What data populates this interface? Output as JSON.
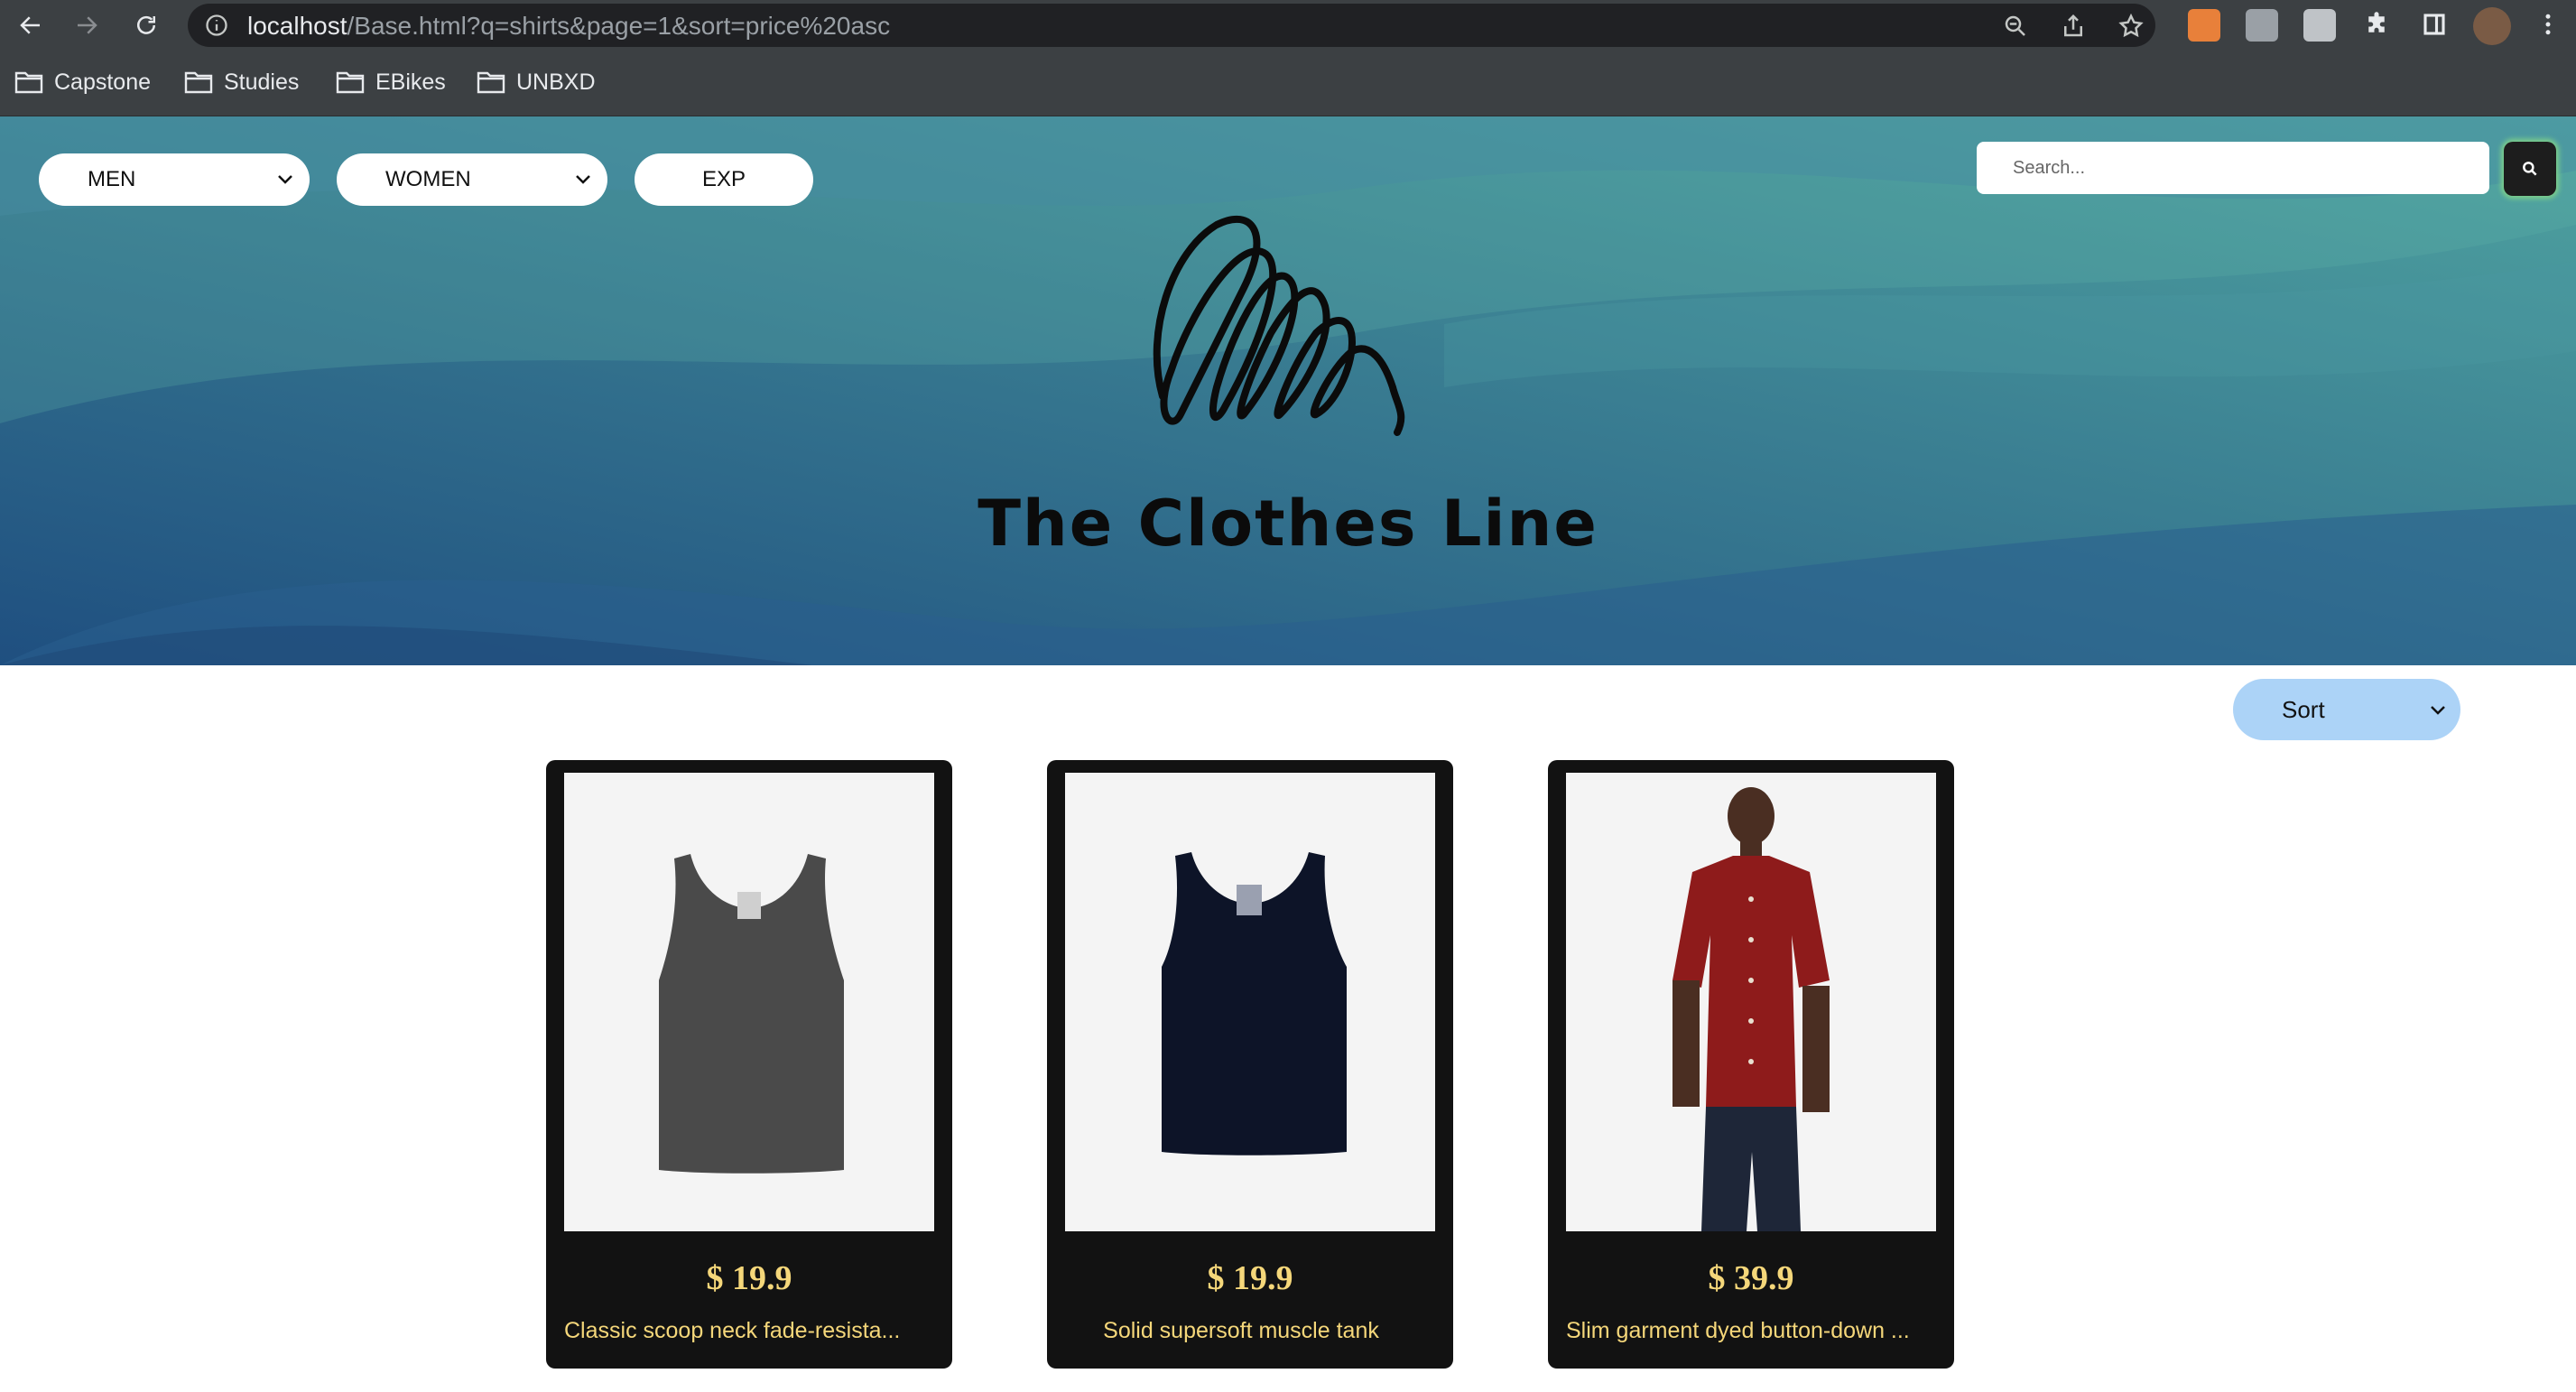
{
  "browser": {
    "url_host": "localhost",
    "url_path": "/Base.html?q=shirts&page=1&sort=price%20asc",
    "bookmarks": [
      "Capstone",
      "Studies",
      "EBikes",
      "UNBXD"
    ],
    "icons": [
      "back-icon",
      "forward-icon",
      "reload-icon",
      "info-icon",
      "zoom-icon",
      "share-icon",
      "star-icon",
      "fox-extension-icon",
      "extension-icon",
      "extension-icon",
      "puzzle-icon",
      "sidebar-icon",
      "avatar",
      "menu-icon"
    ]
  },
  "header": {
    "nav": {
      "men": "MEN",
      "women": "WOMEN",
      "exp": "EXP"
    },
    "search_placeholder": "Search...",
    "title": "The Clothes Line"
  },
  "sort": {
    "label": "Sort"
  },
  "products": [
    {
      "price": "$ 19.9",
      "name": "Classic scoop neck fade-resista...",
      "color": "#4a4a4a"
    },
    {
      "price": "$ 19.9",
      "name": "Solid supersoft muscle tank",
      "color": "#0d1428"
    },
    {
      "price": "$ 39.9",
      "name": "Slim garment dyed button-down ...",
      "color": "#8e1b1b"
    }
  ],
  "colors": {
    "price_text": "#f5d77a",
    "card_bg": "#121212",
    "sort_bg": "#acd3f7",
    "hero_dark": "#1f4f80",
    "hero_light": "#4fa3a0"
  }
}
